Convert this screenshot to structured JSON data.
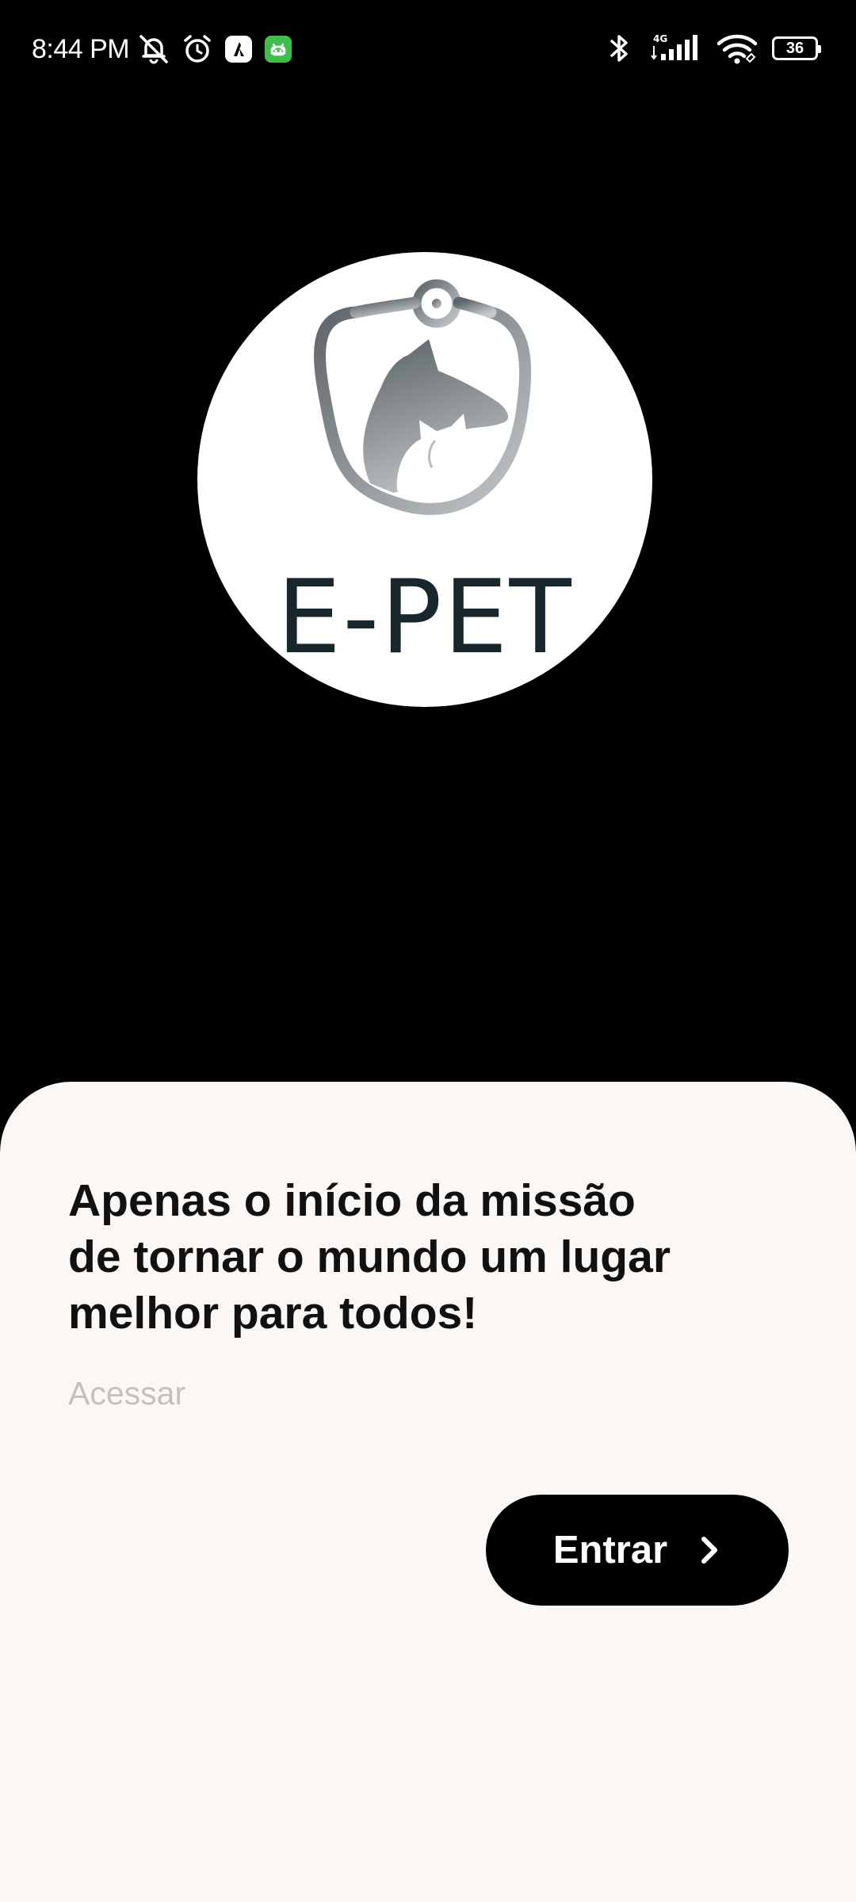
{
  "status_bar": {
    "time": "8:44 PM",
    "network": "4G",
    "battery_level": "36",
    "icons": [
      "muted-bell-icon",
      "alarm-icon",
      "app-notification-icon",
      "android-notification-icon",
      "bluetooth-icon",
      "signal-icon",
      "wifi-icon",
      "battery-icon"
    ]
  },
  "logo": {
    "brand": "E-PET",
    "icon": "stethoscope-dog-cat-logo"
  },
  "sheet": {
    "headline": "Apenas o início da missão\nde tornar o mundo um lugar\nmelhor para todos!",
    "subtitle": "Acessar",
    "enter_button_label": "Entrar",
    "enter_button_icon": "chevron-right-icon"
  },
  "colors": {
    "background": "#000000",
    "sheet_background": "#fbf7f5",
    "button_background": "#000000",
    "button_text": "#ffffff",
    "headline_text": "#111111",
    "subtitle_text": "#c4c0bd",
    "logo_text": "#17272c",
    "notification_green": "#3fbf4a"
  }
}
